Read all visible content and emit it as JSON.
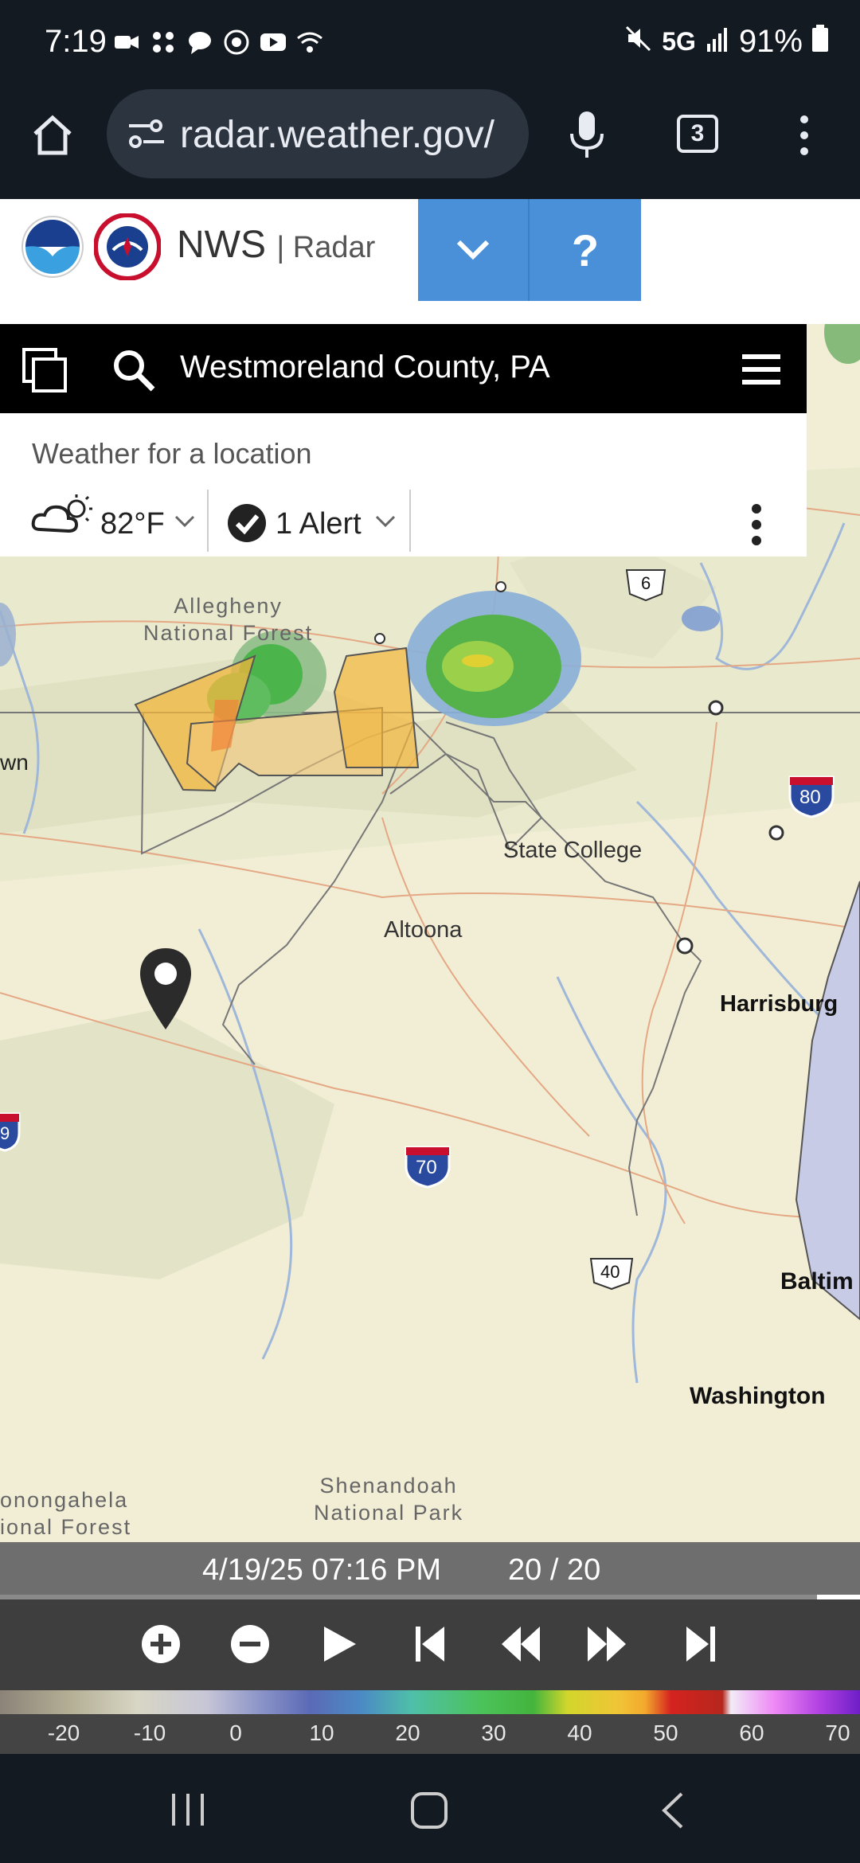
{
  "status_bar": {
    "time": "7:19",
    "network": "5G",
    "battery": "91%",
    "icons": [
      "video-call-icon",
      "apps-icon",
      "chat-icon",
      "cast-icon",
      "youtube-icon",
      "wifi-icon"
    ]
  },
  "browser": {
    "url": "radar.weather.gov/",
    "tab_count": "3",
    "icons": [
      "home-icon",
      "site-settings-icon",
      "mic-icon",
      "tabs-icon",
      "more-menu-icon"
    ]
  },
  "nws_header": {
    "title": "NWS",
    "subtitle": "| Radar",
    "dropdown_symbol": "⌄",
    "help_symbol": "?"
  },
  "search": {
    "location": "Westmoreland County, PA"
  },
  "weather_panel": {
    "header": "Weather for a location",
    "temperature": "82°F",
    "alert": "1 Alert"
  },
  "map": {
    "labels": {
      "allegheny": "Allegheny\nNational Forest",
      "state_college": "State College",
      "altoona": "Altoona",
      "harrisburg": "Harrisburg",
      "baltimore": "Baltim",
      "washington": "Washington",
      "shenandoah": "Shenandoah\nNational Park",
      "monongahela": "onongahela\nional Forest",
      "left_edge_wn": "wn",
      "left_shield_9": "9"
    },
    "shields": {
      "us6": "6",
      "i80": "80",
      "i70": "70",
      "us40": "40"
    }
  },
  "timeline": {
    "timestamp": "4/19/25 07:16 PM",
    "frame": "20 / 20",
    "progress": 0.95,
    "controls": [
      "zoom-in-icon",
      "zoom-out-icon",
      "play-icon",
      "first-frame-icon",
      "step-back-icon",
      "step-forward-icon",
      "last-frame-icon"
    ]
  },
  "legend": {
    "labels": [
      "-20",
      "-10",
      "0",
      "10",
      "20",
      "30",
      "40",
      "50",
      "60",
      "70"
    ]
  },
  "nav_bar": {
    "icons": [
      "recent-apps-icon",
      "home-nav-icon",
      "back-icon"
    ]
  }
}
